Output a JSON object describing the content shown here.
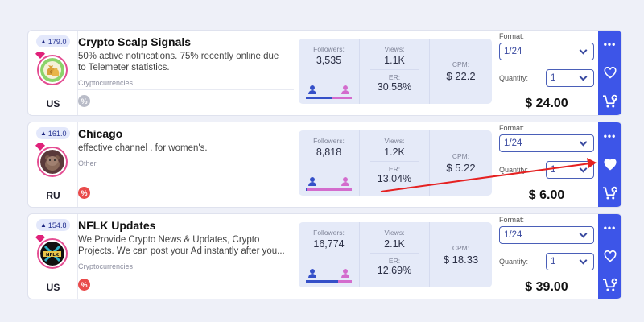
{
  "labels": {
    "followers": "Followers:",
    "views": "Views:",
    "er": "ER:",
    "cpm": "CPM:",
    "format": "Format:",
    "quantity": "Quantity:",
    "discount_symbol": "%"
  },
  "icons": {
    "more": "more-dots-icon",
    "favorite": "heart-icon",
    "cart": "add-to-cart-icon",
    "rating": "trophy-icon"
  },
  "colors": {
    "accent": "#3d55e8",
    "male": "#3550c8",
    "female": "#d36ccd",
    "discount_active": "#e94b4b",
    "discount_inactive": "#b9bcc8",
    "annotation_arrow": "#e52121"
  },
  "channels": [
    {
      "rating": "179.0",
      "name": "Crypto Scalp Signals",
      "description": "50% active notifications. 75% recently online due to Telemeter statistics.",
      "category": "Cryptocurrencies",
      "country": "US",
      "discount_active": false,
      "followers": "3,535",
      "views": "1.1K",
      "er": "30.58%",
      "cpm": "$ 22.2",
      "male_share": 0.58,
      "format": "1/24",
      "quantity": "1",
      "price": "$ 24.00",
      "favorited": false,
      "avatar_icon": "money-bags-icon"
    },
    {
      "rating": "161.0",
      "name": "Chicago",
      "description": "effective channel . for women's.",
      "category": "Other",
      "country": "RU",
      "discount_active": true,
      "followers": "8,818",
      "views": "1.2K",
      "er": "13.04%",
      "cpm": "$ 5.22",
      "male_share": 0.02,
      "format": "1/24",
      "quantity": "1",
      "price": "$ 6.00",
      "favorited": true,
      "avatar_icon": "bear-photo-icon"
    },
    {
      "rating": "154.8",
      "name": "NFLK Updates",
      "description": "We Provide Crypto News & Updates, Crypto Projects. We can post your Ad instantly after you...",
      "category": "Cryptocurrencies",
      "country": "US",
      "discount_active": true,
      "followers": "16,774",
      "views": "2.1K",
      "er": "12.69%",
      "cpm": "$ 18.33",
      "male_share": 0.7,
      "format": "1/24",
      "quantity": "1",
      "price": "$ 39.00",
      "favorited": false,
      "avatar_icon": "nflk-logo-icon",
      "avatar_text": "NFLK"
    }
  ]
}
